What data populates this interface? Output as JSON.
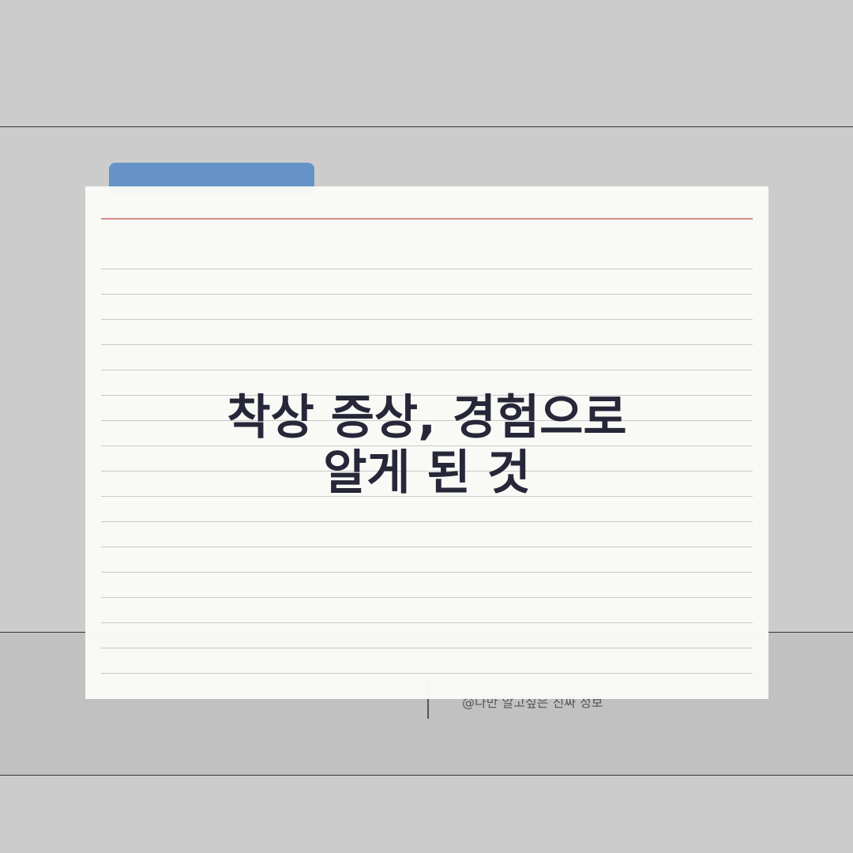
{
  "colors": {
    "background": "#cccccc",
    "tab": "#6593c7",
    "margin_line": "#d48a8a",
    "title_text": "#262738"
  },
  "card": {
    "title_line1": "착상 증상, 경험으로",
    "title_line2": "알게 된 것"
  },
  "footer": {
    "credit": "@나만 알고싶은 진짜 정보"
  }
}
